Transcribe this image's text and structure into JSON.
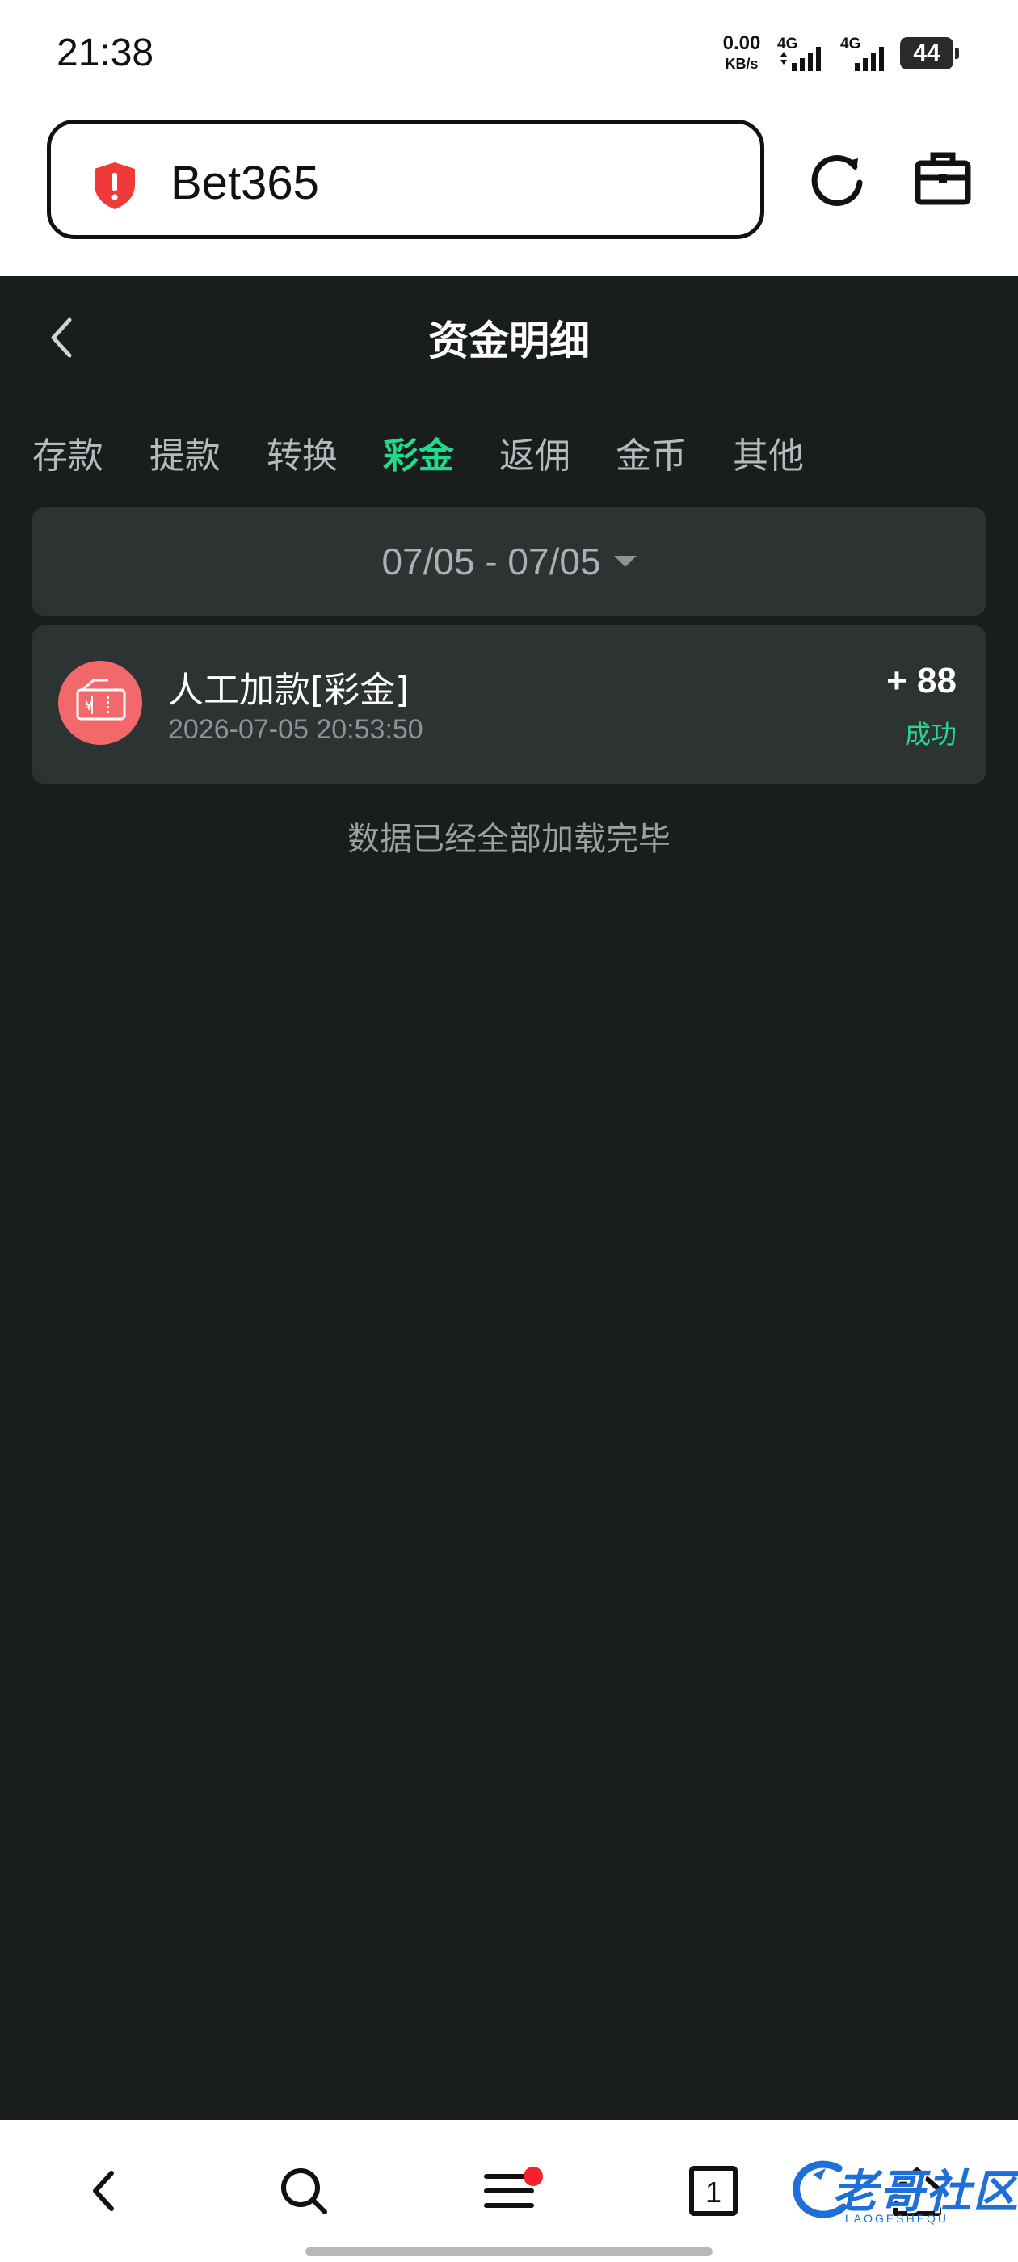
{
  "status_bar": {
    "time": "21:38",
    "net_speed_value": "0.00",
    "net_speed_unit": "KB/s",
    "sim1_label": "4G",
    "sim2_label": "4G",
    "battery": "44"
  },
  "browser": {
    "site_name": "Bet365",
    "security_icon": "shield-alert-icon",
    "reload_icon": "reload-icon",
    "toolbox_icon": "toolbox-icon"
  },
  "page": {
    "title": "资金明细",
    "tabs": [
      {
        "label": "存款",
        "active": false
      },
      {
        "label": "提款",
        "active": false
      },
      {
        "label": "转换",
        "active": false
      },
      {
        "label": "彩金",
        "active": true
      },
      {
        "label": "返佣",
        "active": false
      },
      {
        "label": "金币",
        "active": false
      },
      {
        "label": "其他",
        "active": false
      }
    ],
    "date_range": "07/05 - 07/05",
    "records": [
      {
        "title": "人工加款[彩金]",
        "time": "2026-07-05 20:53:50",
        "amount": "+ 88",
        "status": "成功",
        "icon": "red-envelope-icon"
      }
    ],
    "end_note": "数据已经全部加载完毕"
  },
  "bottom_nav": {
    "items": [
      "back-icon",
      "search-icon",
      "menu-icon",
      "tabs-icon",
      "home-icon"
    ],
    "tab_count": "1"
  },
  "watermark": {
    "text": "老哥社区",
    "sub": "LAOGESHEQU"
  },
  "colors": {
    "accent": "#22d98c",
    "background": "#191d1c",
    "card": "#2d3233",
    "alert": "#f5222d"
  }
}
